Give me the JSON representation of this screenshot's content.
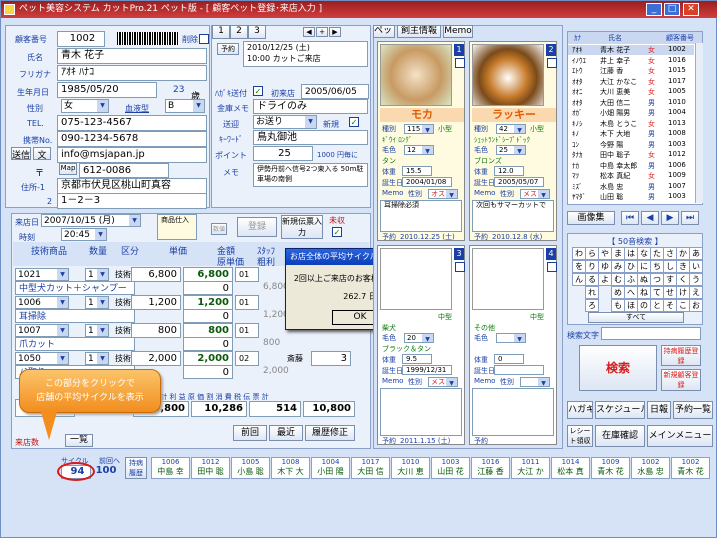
{
  "window": {
    "title": "ペット美容システム  カットPro.21 ペット版 - [  顧客ペット登録･来店入力  ]"
  },
  "customer": {
    "no_label": "顧客番号",
    "no": "1002",
    "delete_label": "削除",
    "name_label": "氏名",
    "name": "青木  花子",
    "kana_label": "フリガナ",
    "kana": "ｱｵｷ ﾊﾅｺ",
    "birth_label": "生年月日",
    "birth": "1985/05/20",
    "age": "23",
    "age_unit": "歳",
    "sex_label": "性別",
    "sex": "女",
    "blood_label": "血液型",
    "blood": "B",
    "tel_label": "TEL.",
    "tel": "075-123-4567",
    "mobile_label": "携帯No.",
    "mobile": "090-1234-5678",
    "mail_label1": "送信",
    "mail_label2": "文",
    "email": "info@msjapan.jp",
    "zip_sym": "〒",
    "map_label": "Map",
    "zip": "612-0086",
    "addr_label": "住所-1",
    "addr1": "京都市伏見区桃山町真容",
    "addr2_label": "2",
    "addr2": "1－2－3"
  },
  "tabs_top": [
    "1",
    "2",
    "3"
  ],
  "yoyaku": {
    "label": "予約",
    "value": "2010/12/25 (土)",
    "note": "10:00 カットご来店"
  },
  "mid": {
    "hagaki_label": "ﾊｶﾞｷ送付",
    "first_visit_label": "初来店",
    "first_visit": "2005/06/05",
    "memo_label": "金庫メモ",
    "memo": "ドライのみ",
    "send_label": "送迎",
    "send": "お送り",
    "new_label": "新規",
    "keyword_label": "ｷｰﾜｰﾄﾞ",
    "keyword": "鳥丸御池",
    "point_label": "ポイント",
    "point": "25",
    "point_unit": "1000 円毎に",
    "memo2_label": "メモ",
    "memo2": "伊勢丹前へ信号2つ東入る 50m駐車場の南側"
  },
  "visit": {
    "date_label": "来店日",
    "date": "2007/10/15 (月)",
    "time_label": "時刻",
    "time": "20:45",
    "shohin_label": "商品仕入",
    "register_label": "登録",
    "new_slip_label": "新規伝票入力",
    "unpaid_label": "未収",
    "cancel_label": "数値",
    "headers": [
      "技術商品",
      "数量",
      "区分",
      "単価",
      "金額",
      "ｽﾀｯﾌ",
      "原単価",
      "粗利"
    ],
    "rows": [
      {
        "code": "1021",
        "qty": "1",
        "kind": "技術",
        "price": "6,800",
        "amount": "6,800",
        "flag": "01",
        "cost": "0",
        "name": "中型犬カット＋シャンプー",
        "gross": "6,800"
      },
      {
        "code": "1006",
        "qty": "1",
        "kind": "技術",
        "price": "1,200",
        "amount": "1,200",
        "flag": "01",
        "cost": "0",
        "name": "耳掃除",
        "gross": "1,200"
      },
      {
        "code": "1007",
        "qty": "1",
        "kind": "技術",
        "price": "800",
        "amount": "800",
        "flag": "01",
        "cost": "0",
        "name": "爪カット",
        "gross": "800"
      },
      {
        "code": "1050",
        "qty": "1",
        "kind": "技術",
        "price": "2,000",
        "amount": "2,000",
        "flag": "02",
        "cost": "0",
        "name": "ﾉﾐ取り",
        "staff": "斎藤",
        "staffno": "3",
        "gross": "2,000"
      }
    ],
    "totals_label": "合  計   利  益  原 価  割  消  費  税  伝  票  計",
    "totals": [
      "10,800",
      "10,286",
      "514",
      "10,800"
    ],
    "buttons": [
      "前回",
      "最近",
      "履歴修正"
    ],
    "visit_count_label": "来店数",
    "list_label": "一覧",
    "cycle_label": "サイクル",
    "prev_label": "前回へ",
    "cycle_value": "94",
    "cycle_next": "100",
    "pet_history_label": "持病履歴"
  },
  "popup": {
    "title": "お店全体の平均サイクル",
    "message": "2回以上ご来店のお客様の平均です。",
    "value": "262.7  日",
    "ok": "OK"
  },
  "callout": {
    "line1": "この部分をクリックで",
    "line2": "店舗の平均サイクルを表示"
  },
  "pet_tabs": [
    "ペット",
    "飼主情報",
    "Memo"
  ],
  "pets": [
    {
      "num": "1",
      "name": "モカ",
      "shu_label": "種別",
      "shu": "115",
      "size": "小型",
      "breed": "ｷﾞｳｲ ﾛﾝｸﾞ",
      "color_label": "毛色",
      "color": "12",
      "color_name": "タン",
      "weight_label": "体重",
      "weight": "15.5",
      "birth_label": "誕生日",
      "birth": "2004/01/08",
      "memo_label": "Memo",
      "sex_label": "性別",
      "sex": "オス",
      "memo": "耳掃除必須",
      "next_label": "予約",
      "next": "2010.12.25 (土)"
    },
    {
      "num": "2",
      "name": "ラッキー",
      "shu_label": "種別",
      "shu": "42",
      "size": "小型",
      "breed": "ｼｪｯﾄﾗﾝﾄﾞｼｰﾌﾟﾄﾞｯｸ",
      "color_label": "毛色",
      "color": "25",
      "color_name": "ブロンズ",
      "weight_label": "体重",
      "weight": "12.0",
      "birth_label": "誕生日",
      "birth": "2005/05/07",
      "memo_label": "Memo",
      "sex_label": "性別",
      "sex": "メス",
      "memo": "次回もサマーカットで",
      "next_label": "予約",
      "next": "2010.12.8 (水)"
    },
    {
      "num": "3",
      "size": "中型",
      "breed": "柴犬",
      "color_label": "毛色",
      "color": "20",
      "color_name": "ブラック＆タン",
      "weight_label": "体重",
      "weight": "9.5",
      "birth_label": "誕生日",
      "birth": "1999/12/31",
      "memo_label": "Memo",
      "sex_label": "性別",
      "sex": "メス",
      "next_label": "予約",
      "next": "2011.1.15 (土)"
    },
    {
      "num": "4",
      "size": "中型",
      "breed": "その他",
      "color_label": "毛色",
      "color": "",
      "weight_label": "体重",
      "weight": "0",
      "birth_label": "誕生日",
      "memo_label": "Memo",
      "sex_label": "性別",
      "sex": "",
      "next_label": "予約"
    }
  ],
  "list": {
    "headers": [
      "ｶﾅ",
      "氏名",
      "顧客番号"
    ],
    "rows": [
      [
        "ｱｵｷ",
        "青木 花子",
        "女",
        "1002"
      ],
      [
        "ｲﾉｳｴ",
        "井上 幸子",
        "女",
        "1016"
      ],
      [
        "ｴﾄｳ",
        "江藤 香",
        "女",
        "1015"
      ],
      [
        "ｵｵﾀ",
        "大江 かなこ",
        "女",
        "1017"
      ],
      [
        "ｵｵﾆ",
        "大川 恵美",
        "女",
        "1005"
      ],
      [
        "ｵｵﾀ",
        "大田 信二",
        "男",
        "1010"
      ],
      [
        "ｵｶﾞ",
        "小畑 陽男",
        "男",
        "1004"
      ],
      [
        "ｷﾉｼ",
        "木島 とうこ",
        "女",
        "1013"
      ],
      [
        "ｷﾉ",
        "木下 大地",
        "男",
        "1008"
      ],
      [
        "ｺﾝ",
        "今野 陽",
        "男",
        "1003"
      ],
      [
        "ﾀﾅｶ",
        "田中 聡子",
        "女",
        "1012"
      ],
      [
        "ﾅｶ",
        "中島 幸太郎",
        "男",
        "1006"
      ],
      [
        "ﾏﾂ",
        "松本 真紀",
        "女",
        "1009"
      ],
      [
        "ﾐｽﾞ",
        "水島 忠",
        "男",
        "1007"
      ],
      [
        "ﾔﾏﾀﾞ",
        "山田 聡",
        "男",
        "1003"
      ]
    ],
    "image_label": "画像集",
    "search_label": "【 50音検索 】",
    "kana": [
      "わ",
      "ら",
      "や",
      "ま",
      "は",
      "な",
      "た",
      "さ",
      "か",
      "あ",
      "を",
      "り",
      "ゆ",
      "み",
      "ひ",
      "に",
      "ち",
      "し",
      "き",
      "い",
      "ん",
      "る",
      "よ",
      "む",
      "ふ",
      "ぬ",
      "つ",
      "す",
      "く",
      "う",
      "",
      "れ",
      "",
      "め",
      "へ",
      "ね",
      "て",
      "せ",
      "け",
      "え",
      "",
      "ろ",
      "",
      "も",
      "ほ",
      "の",
      "と",
      "そ",
      "こ",
      "お"
    ],
    "all_label": "すべて",
    "search_text_label": "検索文字",
    "search_btn": "検索",
    "sick_label": "持病履歴登録",
    "new_cust_label": "新規顧客登録"
  },
  "right_buttons": [
    "ハガキ",
    "スケジュール",
    "日報",
    "予約一覧",
    "レシート領収書",
    "在庫確認",
    "メインメニュー"
  ],
  "bottom_list": [
    {
      "no": "1006",
      "name": "中島 幸"
    },
    {
      "no": "1012",
      "name": "田中 聡"
    },
    {
      "no": "1005",
      "name": "小島 聡"
    },
    {
      "no": "1008",
      "name": "木下 大"
    },
    {
      "no": "1004",
      "name": "小田 陽"
    },
    {
      "no": "1017",
      "name": "大田 信"
    },
    {
      "no": "1010",
      "name": "大川 恵"
    },
    {
      "no": "1003",
      "name": "山田 花"
    },
    {
      "no": "1016",
      "name": "江藤 香"
    },
    {
      "no": "1011",
      "name": "大江 か"
    },
    {
      "no": "1014",
      "name": "松本 真"
    },
    {
      "no": "1009",
      "name": "青木 花"
    },
    {
      "no": "1002",
      "name": "水島 忠"
    },
    {
      "no": "1002",
      "name": "青木 花"
    }
  ]
}
